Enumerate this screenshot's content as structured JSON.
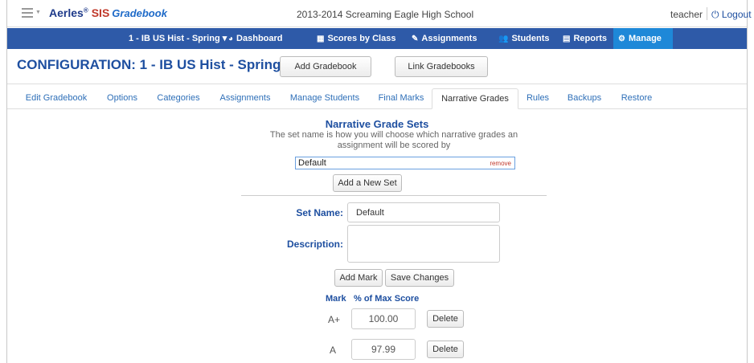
{
  "header": {
    "brand_main": "Aerles",
    "brand_reg": "®",
    "brand_sis": "SIS",
    "brand_gradebook": "Gradebook",
    "school": "2013-2014 Screaming Eagle High School",
    "user": "teacher",
    "logout": "Logout"
  },
  "nav": {
    "course": "1 - IB US Hist - Spring",
    "items": [
      "Dashboard",
      "Scores by Class",
      "Assignments",
      "Students",
      "Reports",
      "Manage"
    ]
  },
  "config": {
    "title": "CONFIGURATION: 1 - IB US Hist - Spring",
    "add_gradebook": "Add Gradebook",
    "link_gradebooks": "Link Gradebooks"
  },
  "tabs": [
    "Edit Gradebook",
    "Options",
    "Categories",
    "Assignments",
    "Manage Students",
    "Final Marks",
    "Narrative Grades",
    "Rules",
    "Backups",
    "Restore"
  ],
  "sets": {
    "title": "Narrative Grade Sets",
    "description": "The set name is how you will choose which narrative grades an assignment will be scored by",
    "selected": "Default",
    "remove": "remove",
    "add_new": "Add a New Set"
  },
  "form": {
    "set_name_label": "Set Name:",
    "set_name_value": "Default",
    "description_label": "Description:",
    "add_mark": "Add Mark",
    "save_changes": "Save Changes",
    "col_mark": "Mark",
    "col_pct": "% of Max Score",
    "delete": "Delete"
  },
  "marks": [
    {
      "mark": "A+",
      "pct": "100.00"
    },
    {
      "mark": "A",
      "pct": "97.99"
    }
  ],
  "colors": {
    "nav_bg": "#2e5aa8",
    "nav_active": "#1e88d8",
    "heading": "#1e4fa0",
    "remove": "#c0392b"
  }
}
